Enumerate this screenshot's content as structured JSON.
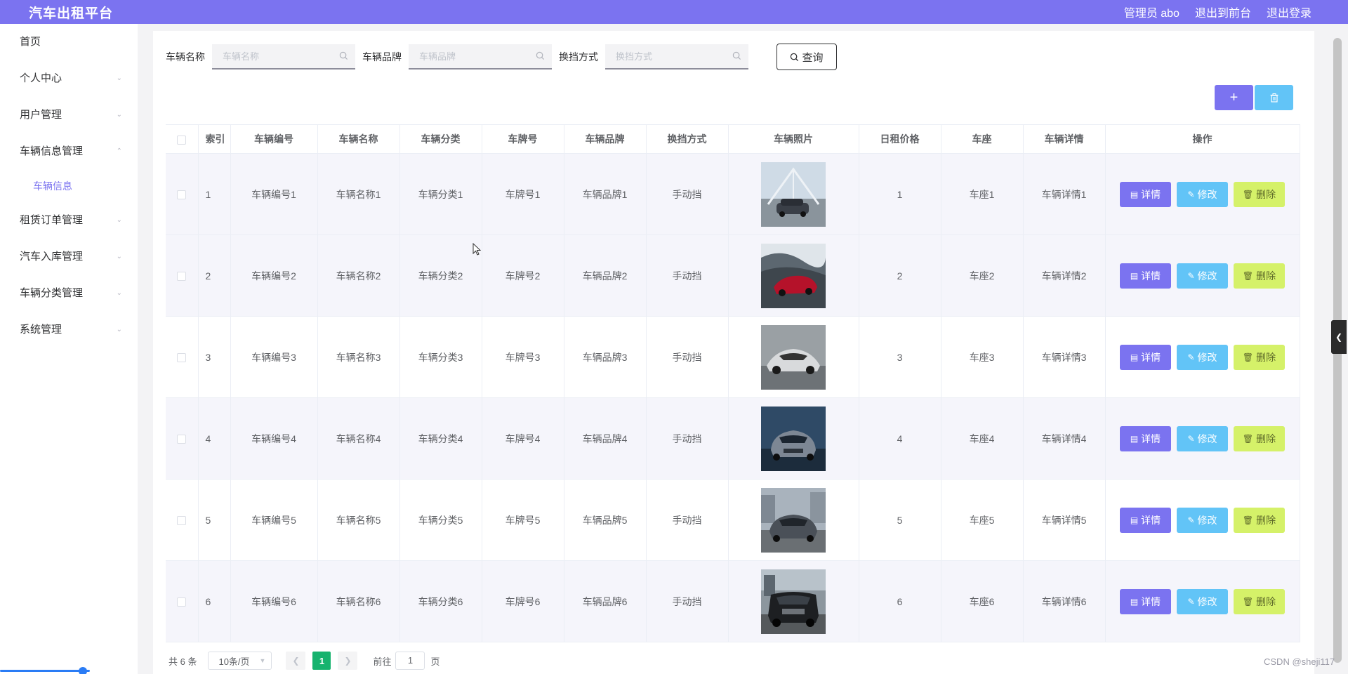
{
  "header": {
    "brand": "汽车出租平台",
    "user": "管理员 abo",
    "back_to_front": "退出到前台",
    "logout": "退出登录",
    "accent": "#7b73f0"
  },
  "sidebar": {
    "items": [
      {
        "label": "首页"
      },
      {
        "label": "个人中心"
      },
      {
        "label": "用户管理"
      },
      {
        "label": "车辆信息管理"
      },
      {
        "label": "车辆信息"
      },
      {
        "label": "租赁订单管理"
      },
      {
        "label": "汽车入库管理"
      },
      {
        "label": "车辆分类管理"
      },
      {
        "label": "系统管理"
      }
    ]
  },
  "search": {
    "name_label": "车辆名称",
    "name_placeholder": "车辆名称",
    "brand_label": "车辆品牌",
    "brand_placeholder": "车辆品牌",
    "gear_label": "换挡方式",
    "gear_placeholder": "换挡方式",
    "query_label": "查询"
  },
  "toolbar": {
    "add_icon": "plus-icon",
    "batch_delete_icon": "trash-icon"
  },
  "table": {
    "columns": [
      "索引",
      "车辆编号",
      "车辆名称",
      "车辆分类",
      "车牌号",
      "车辆品牌",
      "换挡方式",
      "车辆照片",
      "日租价格",
      "车座",
      "车辆详情",
      "操作"
    ],
    "rows": [
      {
        "index": "1",
        "code": "车辆编号1",
        "name": "车辆名称1",
        "category": "车辆分类1",
        "plate": "车牌号1",
        "brand": "车辆品牌1",
        "gear": "手动挡",
        "price": "1",
        "seat": "车座1",
        "detail": "车辆详情1"
      },
      {
        "index": "2",
        "code": "车辆编号2",
        "name": "车辆名称2",
        "category": "车辆分类2",
        "plate": "车牌号2",
        "brand": "车辆品牌2",
        "gear": "手动挡",
        "price": "2",
        "seat": "车座2",
        "detail": "车辆详情2"
      },
      {
        "index": "3",
        "code": "车辆编号3",
        "name": "车辆名称3",
        "category": "车辆分类3",
        "plate": "车牌号3",
        "brand": "车辆品牌3",
        "gear": "手动挡",
        "price": "3",
        "seat": "车座3",
        "detail": "车辆详情3"
      },
      {
        "index": "4",
        "code": "车辆编号4",
        "name": "车辆名称4",
        "category": "车辆分类4",
        "plate": "车牌号4",
        "brand": "车辆品牌4",
        "gear": "手动挡",
        "price": "4",
        "seat": "车座4",
        "detail": "车辆详情4"
      },
      {
        "index": "5",
        "code": "车辆编号5",
        "name": "车辆名称5",
        "category": "车辆分类5",
        "plate": "车牌号5",
        "brand": "车辆品牌5",
        "gear": "手动挡",
        "price": "5",
        "seat": "车座5",
        "detail": "车辆详情5"
      },
      {
        "index": "6",
        "code": "车辆编号6",
        "name": "车辆名称6",
        "category": "车辆分类6",
        "plate": "车牌号6",
        "brand": "车辆品牌6",
        "gear": "手动挡",
        "price": "6",
        "seat": "车座6",
        "detail": "车辆详情6"
      }
    ],
    "ops": {
      "detail": "详情",
      "edit": "修改",
      "delete": "删除"
    }
  },
  "pagination": {
    "total": "共 6 条",
    "page_size": "10条/页",
    "current_page": "1",
    "goto_prefix": "前往",
    "goto_value": "1",
    "goto_suffix": "页"
  },
  "watermark": "CSDN @sheji117"
}
